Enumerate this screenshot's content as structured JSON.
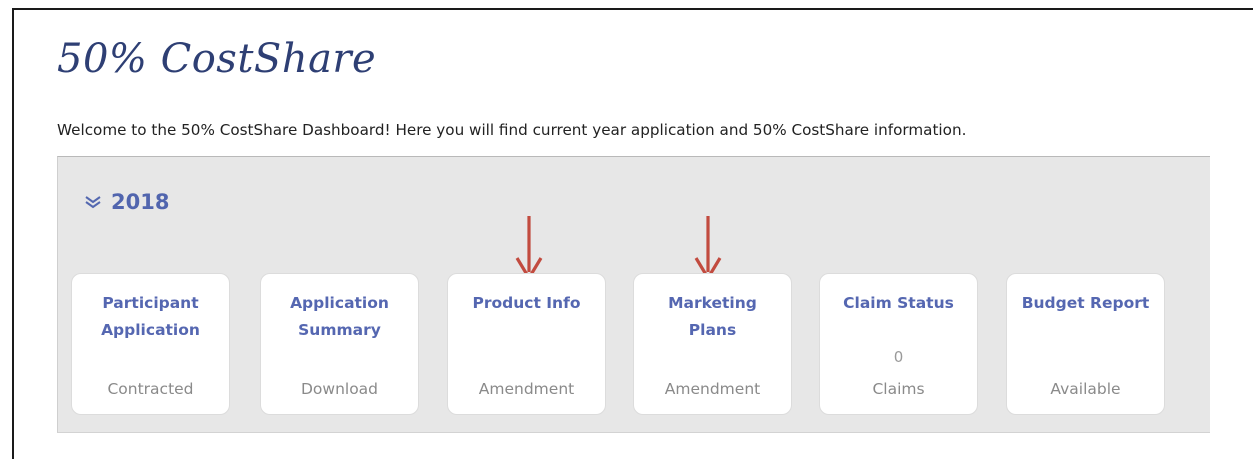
{
  "header": {
    "title": "50% CostShare",
    "welcome": "Welcome to the 50% CostShare Dashboard! Here you will find current year application and 50% CostShare information."
  },
  "year_section": {
    "year": "2018",
    "toggle_icon": "double-chevron-down-icon"
  },
  "cards": [
    {
      "title_line1": "Participant",
      "title_line2": "Application",
      "count": "",
      "status": "Contracted"
    },
    {
      "title_line1": "Application",
      "title_line2": "Summary",
      "count": "",
      "status": "Download"
    },
    {
      "title_line1": "Product Info",
      "title_line2": "",
      "count": "",
      "status": "Amendment"
    },
    {
      "title_line1": "Marketing",
      "title_line2": "Plans",
      "count": "",
      "status": "Amendment"
    },
    {
      "title_line1": "Claim Status",
      "title_line2": "",
      "count": "0",
      "status": "Claims"
    },
    {
      "title_line1": "Budget Report",
      "title_line2": "",
      "count": "",
      "status": "Available"
    }
  ],
  "annotations": {
    "arrow_icon": "down-arrow-icon",
    "arrow_color": "#c24b3f"
  },
  "colors": {
    "title": "#2e3f74",
    "card_title": "#5567b1",
    "panel_bg": "#e7e7e7",
    "arrow": "#c24b3f"
  }
}
